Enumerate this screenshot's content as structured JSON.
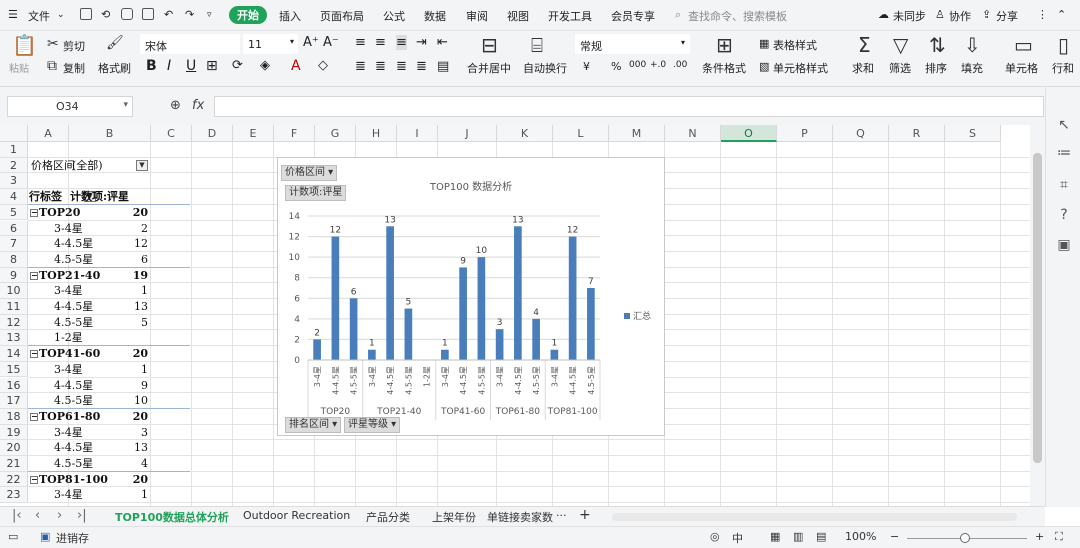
{
  "menu": {
    "file": "文件",
    "tabs": [
      {
        "label": "开始",
        "active": true
      },
      {
        "label": "插入"
      },
      {
        "label": "页面布局"
      },
      {
        "label": "公式"
      },
      {
        "label": "数据"
      },
      {
        "label": "审阅"
      },
      {
        "label": "视图"
      },
      {
        "label": "开发工具"
      },
      {
        "label": "会员专享"
      }
    ],
    "search_placeholder": "查找命令、搜索模板",
    "sync": "未同步",
    "collab": "协作",
    "share": "分享"
  },
  "ribbon": {
    "cut": "剪切",
    "paste": "粘贴",
    "copy": "复制",
    "format_painter": "格式刷",
    "font_name": "宋体",
    "font_size": "11",
    "merge_center": "合并居中",
    "wrap_text": "自动换行",
    "number_format": "常规",
    "conditional_format": "条件格式",
    "table_style": "表格样式",
    "cell_style": "单元格样式",
    "sum": "求和",
    "filter": "筛选",
    "sort": "排序",
    "fill": "填充",
    "cell": "单元格",
    "row_col": "行和"
  },
  "formula_bar": {
    "name_box": "O34",
    "fx": "fx",
    "formula": ""
  },
  "columns": [
    "A",
    "B",
    "C",
    "D",
    "E",
    "F",
    "G",
    "H",
    "I",
    "J",
    "K",
    "L",
    "M",
    "N",
    "O",
    "P",
    "Q",
    "R",
    "S"
  ],
  "selected_column": "O",
  "rows": [
    "1",
    "2",
    "3",
    "4",
    "5",
    "6",
    "7",
    "8",
    "9",
    "10",
    "11",
    "12",
    "13",
    "14",
    "15",
    "16",
    "17",
    "18",
    "19",
    "20",
    "21",
    "22",
    "23"
  ],
  "pivot": {
    "filter_label": "价格区间",
    "filter_value": "(全部)",
    "row_label_header": "行标签",
    "value_header": "计数项:评星",
    "groups": [
      {
        "name": "TOP20",
        "total": "20",
        "items": [
          {
            "label": "3-4星",
            "value": "2"
          },
          {
            "label": "4-4.5星",
            "value": "12"
          },
          {
            "label": "4.5-5星",
            "value": "6"
          }
        ]
      },
      {
        "name": "TOP21-40",
        "total": "19",
        "items": [
          {
            "label": "3-4星",
            "value": "1"
          },
          {
            "label": "4-4.5星",
            "value": "13"
          },
          {
            "label": "4.5-5星",
            "value": "5"
          },
          {
            "label": "1-2星",
            "value": ""
          }
        ]
      },
      {
        "name": "TOP41-60",
        "total": "20",
        "items": [
          {
            "label": "3-4星",
            "value": "1"
          },
          {
            "label": "4-4.5星",
            "value": "9"
          },
          {
            "label": "4.5-5星",
            "value": "10"
          }
        ]
      },
      {
        "name": "TOP61-80",
        "total": "20",
        "items": [
          {
            "label": "3-4星",
            "value": "3"
          },
          {
            "label": "4-4.5星",
            "value": "13"
          },
          {
            "label": "4.5-5星",
            "value": "4"
          }
        ]
      },
      {
        "name": "TOP81-100",
        "total": "20",
        "items": [
          {
            "label": "3-4星",
            "value": "1"
          }
        ]
      }
    ]
  },
  "chart_chips": {
    "filter": "价格区间",
    "value_field": "计数项:评星",
    "axis_field_1": "排名区间",
    "axis_field_2": "评星等级"
  },
  "chart_data": {
    "type": "bar",
    "title": "TOP100 数据分析",
    "xlabel": "",
    "ylabel": "",
    "ylim": [
      0,
      14
    ],
    "yticks": [
      0,
      2,
      4,
      6,
      8,
      10,
      12,
      14
    ],
    "legend": {
      "label": "汇总",
      "position": "right"
    },
    "color": "#4a7ebb",
    "groups": [
      {
        "name": "TOP20",
        "categories": [
          "3-4星",
          "4-4.5星",
          "4.5-5星"
        ],
        "values": [
          2,
          12,
          6
        ]
      },
      {
        "name": "TOP21-40",
        "categories": [
          "3-4星",
          "4-4.5星",
          "4.5-5星",
          "1-2星"
        ],
        "values": [
          1,
          13,
          5,
          null
        ]
      },
      {
        "name": "TOP41-60",
        "categories": [
          "3-4星",
          "4-4.5星",
          "4.5-5星"
        ],
        "values": [
          1,
          9,
          10
        ]
      },
      {
        "name": "TOP61-80",
        "categories": [
          "3-4星",
          "4-4.5星",
          "4.5-5星"
        ],
        "values": [
          3,
          13,
          4
        ]
      },
      {
        "name": "TOP81-100",
        "categories": [
          "3-4星",
          "4-4.5星",
          "4.5-5星"
        ],
        "values": [
          1,
          12,
          7
        ]
      }
    ]
  },
  "sheets": {
    "tabs": [
      {
        "label": "TOP100数据总体分析",
        "active": true
      },
      {
        "label": "Outdoor Recreation"
      },
      {
        "label": "产品分类"
      },
      {
        "label": "上架年份"
      },
      {
        "label": "单链接卖家数"
      }
    ],
    "more": "···",
    "add": "+"
  },
  "status": {
    "macro": "进销存",
    "input_mode": "中",
    "zoom": "100%"
  }
}
